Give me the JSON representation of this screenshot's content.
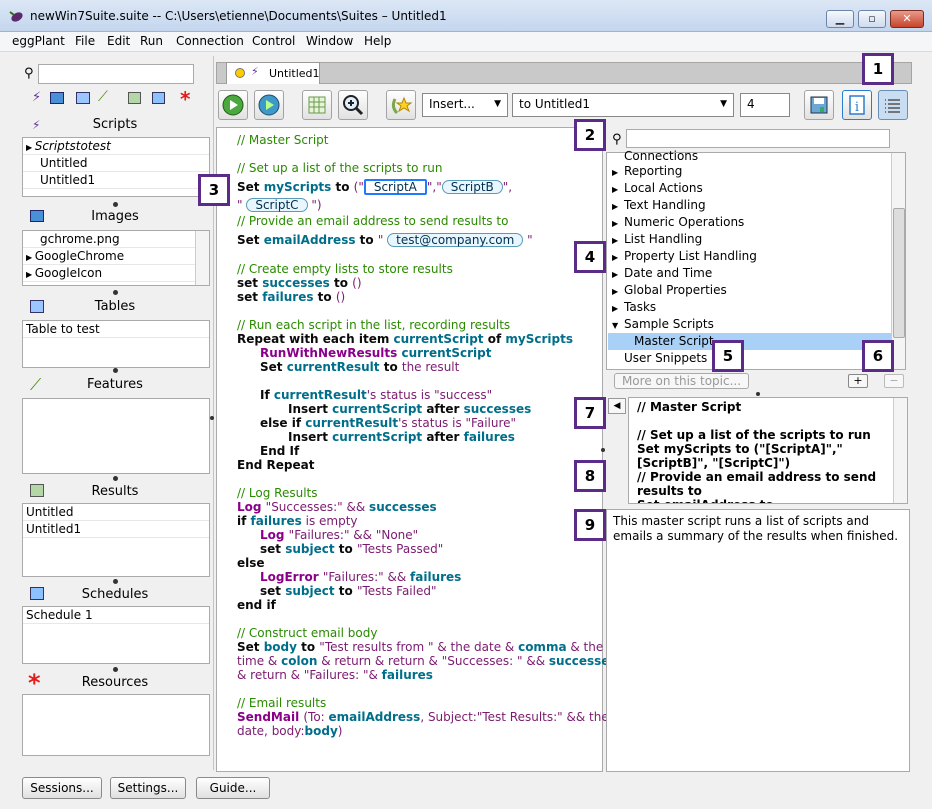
{
  "window": {
    "title": "newWin7Suite.suite -- C:\\Users\\etienne\\Documents\\Suites – Untitled1"
  },
  "menubar": [
    "eggPlant",
    "File",
    "Edit",
    "Run",
    "Connection",
    "Control",
    "Window",
    "Help"
  ],
  "tab": {
    "label": "Untitled1"
  },
  "toolbar": {
    "insert_label": "Insert...",
    "target_label": "to Untitled1",
    "count_value": "4"
  },
  "sidebar": {
    "scripts_header": "Scripts",
    "scripts": [
      "Scriptstotest",
      "Untitled",
      "Untitled1"
    ],
    "images_header": "Images",
    "images": [
      "gchrome.png",
      "GoogleChrome",
      "GoogleIcon"
    ],
    "tables_header": "Tables",
    "tables": [
      "Table to test"
    ],
    "features_header": "Features",
    "results_header": "Results",
    "results": [
      "Untitled",
      "Untitled1"
    ],
    "schedules_header": "Schedules",
    "schedules": [
      "Schedule 1"
    ],
    "resources_header": "Resources"
  },
  "editor": {
    "lines": [
      "// Master Script",
      "// Set up a list of the scripts to run",
      "// Provide an email address to send results to",
      "// Create empty lists to store results",
      "// Run each script in the list, recording results",
      "// Log Results",
      "// Construct email body",
      "// Email results"
    ],
    "pills": [
      "ScriptA",
      "ScriptB",
      "ScriptC",
      "test@company.com"
    ]
  },
  "tree": {
    "items": [
      "Connections",
      "Reporting",
      "Local Actions",
      "Text Handling",
      "Numeric Operations",
      "List Handling",
      "Property List Handling",
      "Date and Time",
      "Global Properties",
      "Tasks",
      "Sample Scripts",
      "Master Script",
      "User Snippets"
    ]
  },
  "more_button": "More on this topic...",
  "help_text": "// Master Script\n\n// Set up a list of the scripts to run\nSet myScripts to (\"[ScriptA]\",\"[ScriptB]\", \"[ScriptC]\")\n// Provide an email address to send results to\nSet emailAddress to",
  "description": "This master script runs a list of scripts and emails a summary of the results when finished.",
  "markers": [
    "1",
    "2",
    "3",
    "4",
    "5",
    "6",
    "7",
    "8",
    "9"
  ],
  "bottom_buttons": [
    "Sessions...",
    "Settings...",
    "Guide..."
  ]
}
